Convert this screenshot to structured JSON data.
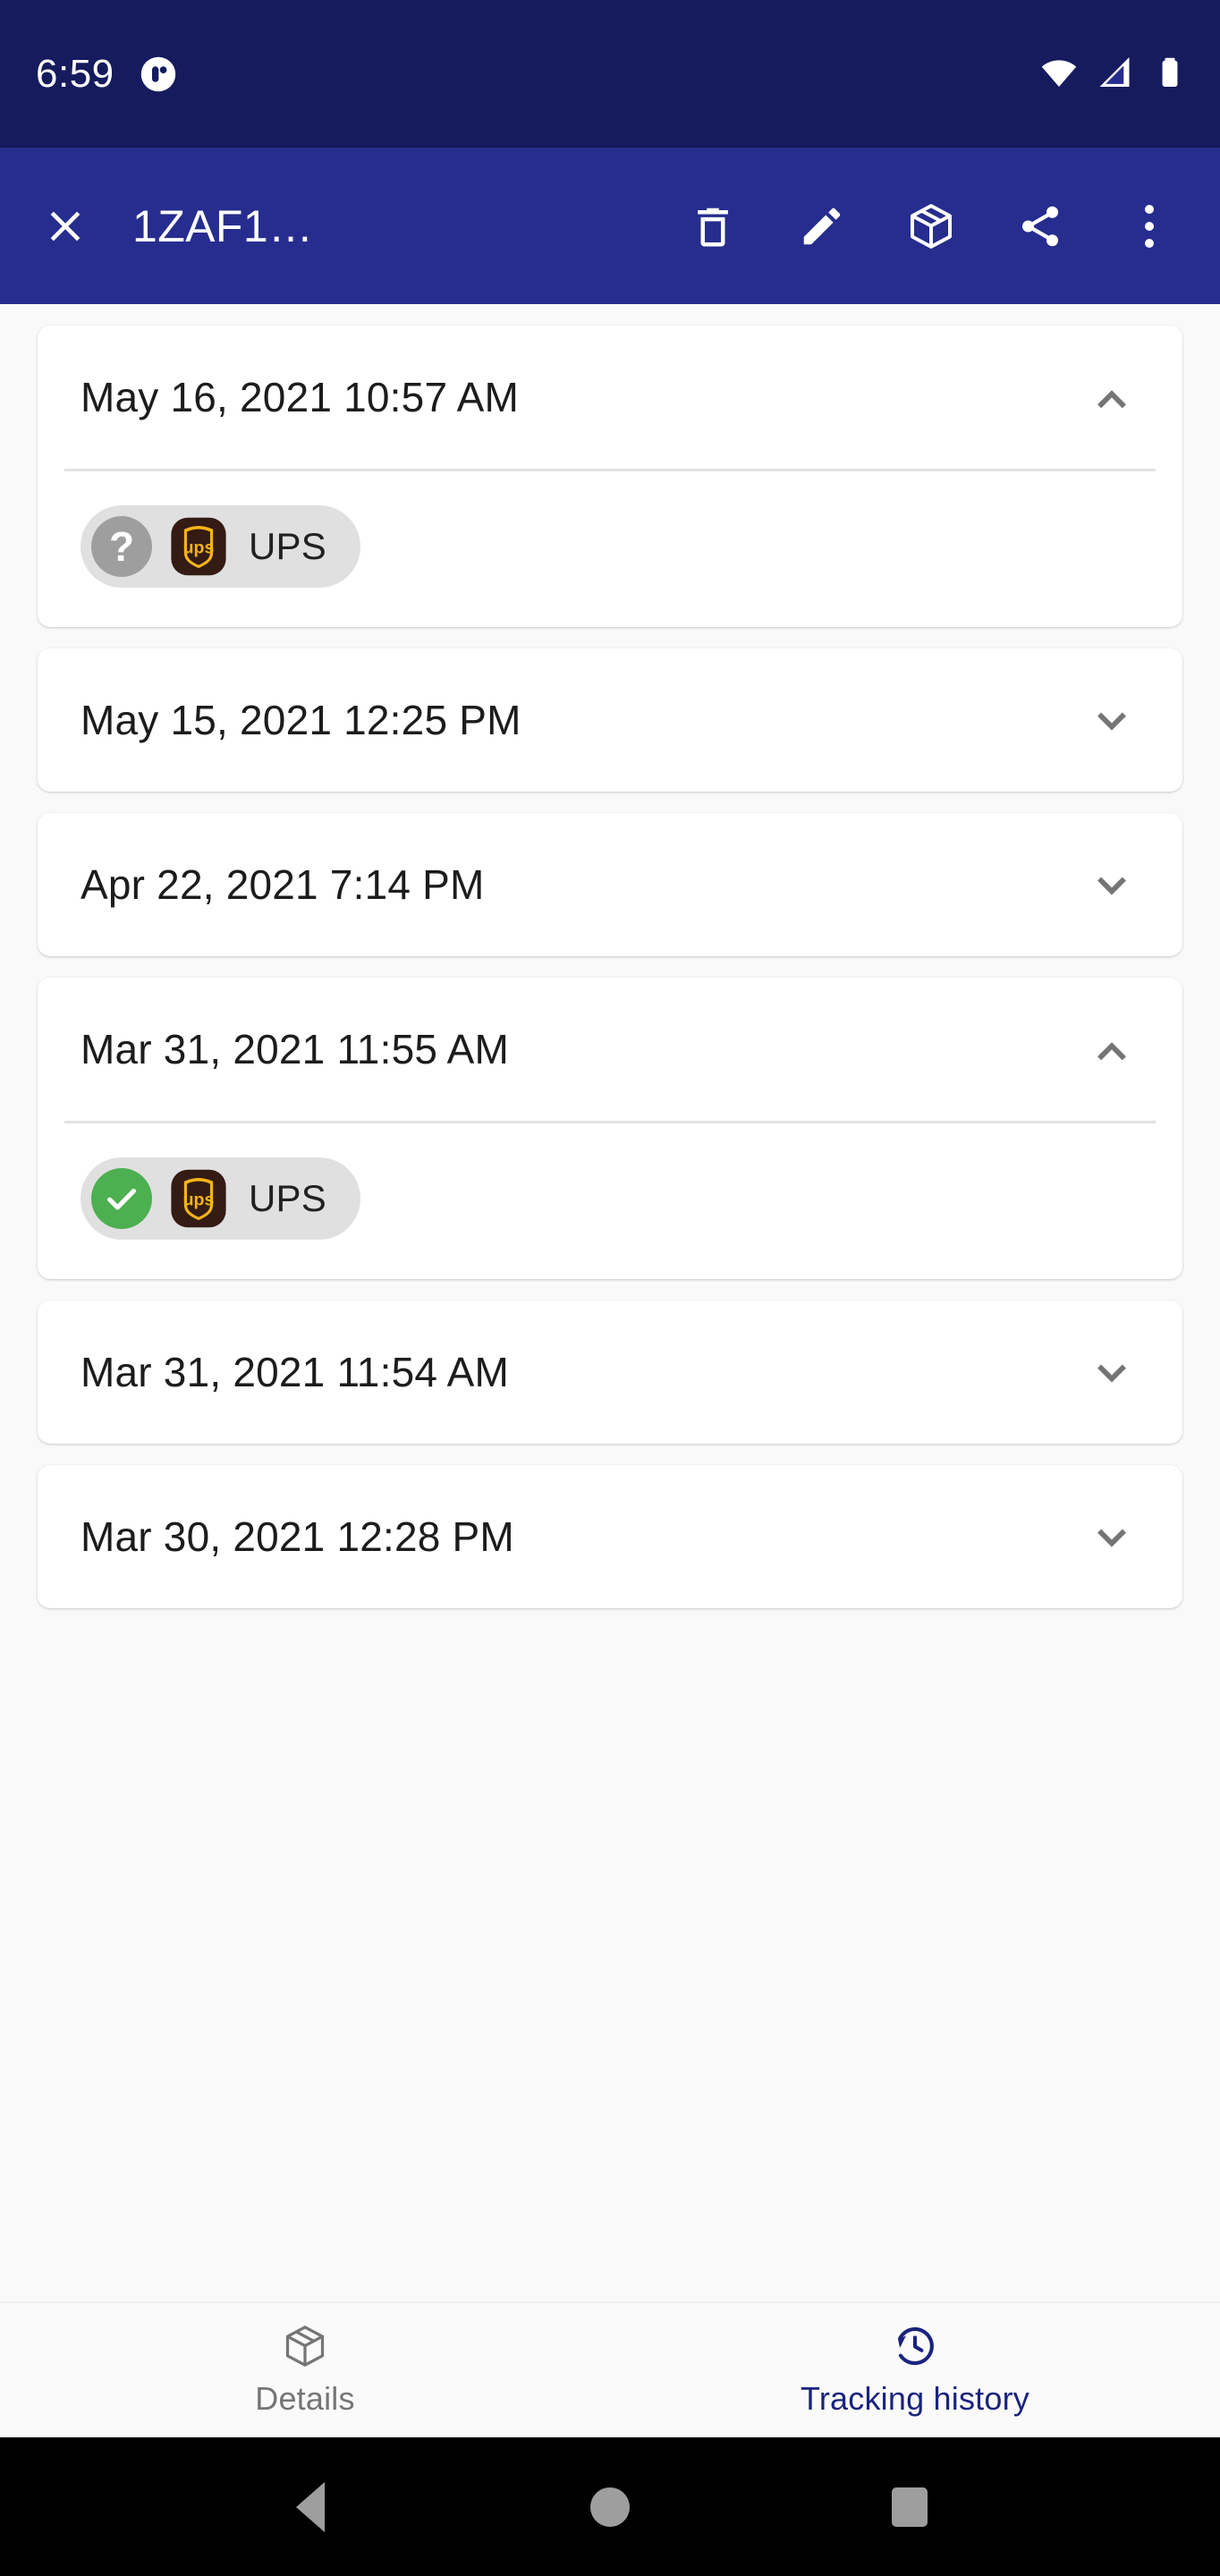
{
  "statusbar": {
    "time": "6:59",
    "notification_icon": "app-notification-icon",
    "wifi_icon": "wifi-icon",
    "signal_icon": "cellular-signal-icon",
    "battery_icon": "battery-full-icon",
    "background_color": "#151b5c"
  },
  "appbar": {
    "close_icon": "close-icon",
    "title": "1ZAF1…",
    "delete_icon": "trash-icon",
    "edit_icon": "pencil-icon",
    "package_icon": "package-icon",
    "share_icon": "share-icon",
    "overflow_icon": "more-vert-icon",
    "background_color": "#262d8e"
  },
  "history": {
    "cards": [
      {
        "date": "May 16, 2021 10:57 AM",
        "expanded": true,
        "chevron": "chevron-up-icon",
        "chip": {
          "status": "unknown",
          "status_glyph": "?",
          "carrier_icon": "ups-logo-icon",
          "carrier": "UPS",
          "status_color": "#9e9e9e"
        }
      },
      {
        "date": "May 15, 2021 12:25 PM",
        "expanded": false,
        "chevron": "chevron-down-icon",
        "chip": null
      },
      {
        "date": "Apr 22, 2021 7:14 PM",
        "expanded": false,
        "chevron": "chevron-down-icon",
        "chip": null
      },
      {
        "date": "Mar 31, 2021 11:55 AM",
        "expanded": true,
        "chevron": "chevron-up-icon",
        "chip": {
          "status": "delivered",
          "status_glyph": "✓",
          "carrier_icon": "ups-logo-icon",
          "carrier": "UPS",
          "status_color": "#4caf50"
        }
      },
      {
        "date": "Mar 31, 2021 11:54 AM",
        "expanded": false,
        "chevron": "chevron-down-icon",
        "chip": null
      },
      {
        "date": "Mar 30, 2021 12:28 PM",
        "expanded": false,
        "chevron": "chevron-down-icon",
        "chip": null
      }
    ]
  },
  "bottomnav": {
    "items": [
      {
        "label": "Details",
        "icon": "package-icon",
        "active": false,
        "color": "#757575"
      },
      {
        "label": "Tracking history",
        "icon": "history-clock-icon",
        "active": true,
        "color": "#1a237e"
      }
    ]
  },
  "androidnav": {
    "back_icon": "back-triangle-icon",
    "home_icon": "home-circle-icon",
    "recents_icon": "recents-square-icon"
  }
}
